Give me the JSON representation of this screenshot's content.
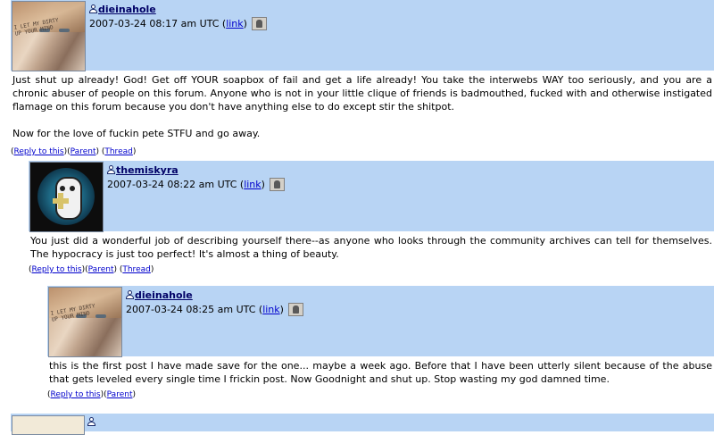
{
  "comments": [
    {
      "username": "dieinahole",
      "avatar_caption": "I LET MY DIRTY\nUP YOUR MIND",
      "date": "2007-03-24 08:17 am UTC",
      "link_label": "link",
      "body": [
        "Just shut up already! God! Get off YOUR soapbox of fail and get a life already! You take the interwebs WAY too seriously, and you are a chronic abuser of people on this forum. Anyone who is not in your little clique of friends is badmouthed, fucked with and otherwise instigated flamage on this forum because you don't have anything else to do except stir the shitpot.",
        "Now for the love of fuckin pete STFU and go away."
      ],
      "actions": {
        "reply": "Reply to this",
        "parent": "Parent",
        "thread": "Thread"
      }
    },
    {
      "username": "themiskyra",
      "date": "2007-03-24 08:22 am UTC",
      "link_label": "link",
      "body": [
        "You just did a wonderful job of describing yourself there--as anyone who looks through the community archives can tell for themselves. The hypocracy is just too perfect! It's almost a thing of beauty."
      ],
      "actions": {
        "reply": "Reply to this",
        "parent": "Parent",
        "thread": "Thread"
      }
    },
    {
      "username": "dieinahole",
      "avatar_caption": "I LET MY DIRTY\nUP YOUR MIND",
      "date": "2007-03-24 08:25 am UTC",
      "link_label": "link",
      "body": [
        "this is the first post I have made save for the one... maybe a week ago. Before that I have been utterly silent because of the abuse that gets leveled every single time I frickin post. Now Goodnight and shut up. Stop wasting my god damned time."
      ],
      "actions": {
        "reply": "Reply to this",
        "parent": "Parent"
      }
    }
  ],
  "colors": {
    "header_bg": "#b8d4f4",
    "link": "#0000cc",
    "username": "#000066"
  },
  "icons": {
    "user": "user-icon",
    "track": "track-icon"
  }
}
